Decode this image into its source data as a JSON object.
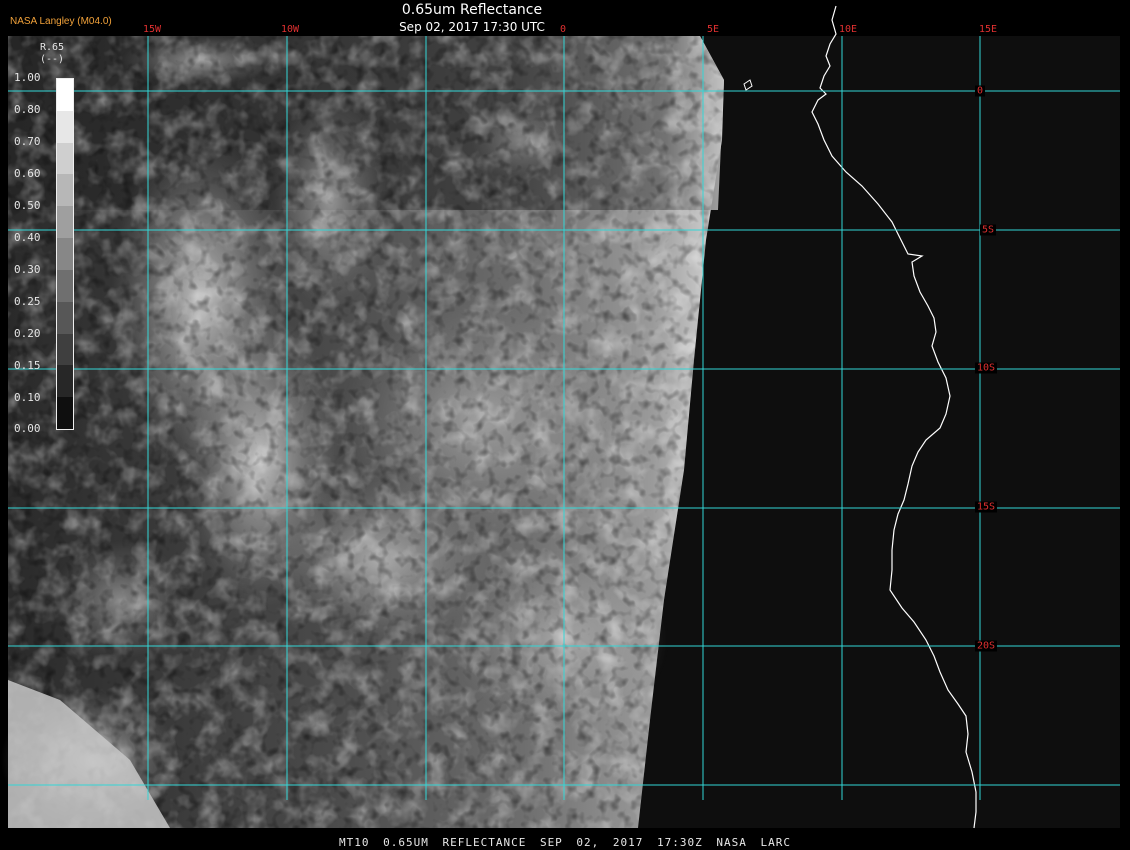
{
  "header": {
    "title": "0.65um Reflectance",
    "subtitle": "Sep 02, 2017 17:30 UTC",
    "credit": "NASA Langley (M04.0)"
  },
  "footer": {
    "caption": "MT10  0.65UM REFLECTANCE  SEP 02, 2017 17:30Z  NASA LARC"
  },
  "grid": {
    "color": "#33d6d6",
    "label_color": "#e03030",
    "longitude_labels": [
      "15W",
      "10W",
      "0",
      "5E",
      "10E",
      "15E"
    ],
    "latitude_labels": [
      "0",
      "5S",
      "10S",
      "15S",
      "20S"
    ]
  },
  "legend": {
    "variable": "R.65",
    "units": "(--)",
    "ticks": [
      "1.00",
      "0.80",
      "0.70",
      "0.60",
      "0.50",
      "0.40",
      "0.30",
      "0.25",
      "0.20",
      "0.15",
      "0.10",
      "0.00"
    ]
  },
  "colors": {
    "background": "#000000",
    "coastline": "#ffffff"
  }
}
